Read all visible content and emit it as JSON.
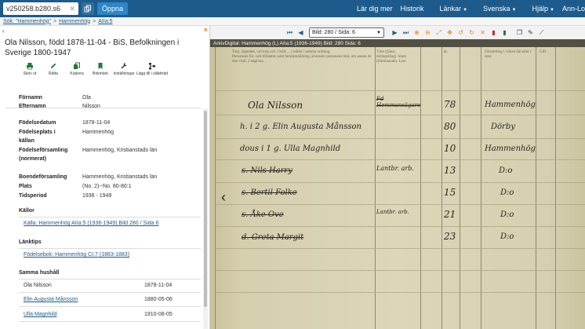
{
  "navbar": {
    "search_value": "v250258.b280.s6",
    "open_label": "Öppna",
    "menu": [
      "Lär dig mer",
      "Historik",
      "Länkar",
      "Svenska",
      "Hjälp",
      "Ann-Lo"
    ]
  },
  "breadcrumb": {
    "items": [
      "Sök: \"Hammenhög\"",
      "Hammenhög",
      "AIIa:5"
    ]
  },
  "panel": {
    "title": "Ola Nilsson, född 1878-11-04 - BiS, Befolkningen i Sverige 1800-1947",
    "tools": [
      "Skriv ut",
      "Rätta",
      "Kopiera",
      "Bokmärk",
      "Inställningar",
      "Lägg till i släktträd"
    ],
    "fields": {
      "fornamn_label": "Förnamn",
      "fornamn": "Ola",
      "efternamn_label": "Efternamn",
      "efternamn": "Nilsson",
      "fodelsedatum_label": "Födelsedatum",
      "fodelsedatum": "1878-11-04",
      "fodelseplats_label": "Födelseplats i",
      "fodelseplats": "Hammenhög",
      "kallan_label": "källan",
      "fodelseforsamling_label": "Födelseförsamling",
      "fodelseforsamling": "Hammenhög, Kristianstads län",
      "normerat_label": "(normerat)",
      "boendeforsamling_label": "Boendeförsamling",
      "boendeforsamling": "Hammenhög, Kristianstads län",
      "plats_label": "Plats",
      "plats": "(No. 2)--No. 80-80:1",
      "tidsperiod_label": "Tidsperiod",
      "tidsperiod": "1936 - 1949"
    },
    "kallor_label": "Källor",
    "kallor_link": "Källa: Hammenhög AIIa:5 (1936-1949) Bild 280 / Sida 6",
    "lanktips_label": "Länktips",
    "lanktips_link": "Födelsebok: Hammenhög CI:7 (1863-1883)",
    "hushall_label": "Samma hushåll",
    "household": [
      {
        "name": "Ola Nilsson",
        "date": "1878-11-04"
      },
      {
        "name": "Elin Augusta Månsson",
        "date": "1880-05-06"
      },
      {
        "name": "Ulla Magnhild",
        "date": "1910-08-05"
      }
    ]
  },
  "viewer": {
    "page_select": "Bild: 280 / Sida: 6",
    "info": "ArkivDigital: Hammenhög (L) AIIa:5 (1936-1949) Bild: 280 Sida: 6",
    "handwriting": {
      "names": [
        "Ola Nilsson",
        "h. i 2 g. Elin Augusta Månsson",
        "dous i 1 g. Ulla Magnhild",
        "s. Nils Harry",
        "s. Bertil Folke",
        "s. Åke Ove",
        "d. Greta Margit"
      ],
      "years": [
        "78",
        "80",
        "10",
        "13",
        "15",
        "21",
        "23"
      ],
      "places": [
        "Hammenhög",
        "Dörby",
        "Hammenhög",
        "D:o",
        "D:o",
        "D:o",
        "D:o"
      ],
      "note_col": [
        "Lantbr. arb.",
        "Lantbr. arb."
      ],
      "occupation": "Fd Hemmansägare"
    }
  }
}
